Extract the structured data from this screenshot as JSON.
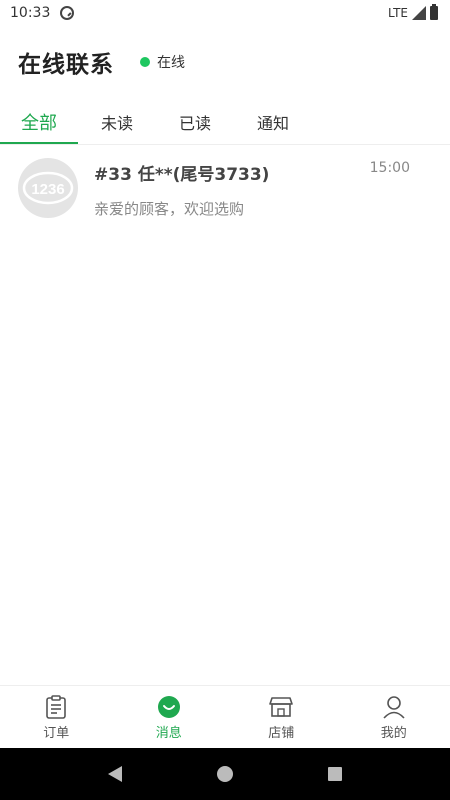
{
  "status_bar": {
    "time": "10:33",
    "network": "LTE"
  },
  "header": {
    "title": "在线联系",
    "status_label": "在线",
    "status_color": "#1ec760"
  },
  "tabs": [
    {
      "label": "全部",
      "active": true
    },
    {
      "label": "未读",
      "active": false
    },
    {
      "label": "已读",
      "active": false
    },
    {
      "label": "通知",
      "active": false
    }
  ],
  "conversations": [
    {
      "name": "#33 任**(尾号3733)",
      "time": "15:00",
      "preview": "亲爱的顾客，欢迎选购",
      "avatar_text": "1236"
    }
  ],
  "bottom_nav": [
    {
      "label": "订单",
      "icon": "clipboard-icon",
      "active": false
    },
    {
      "label": "消息",
      "icon": "message-icon",
      "active": true
    },
    {
      "label": "店铺",
      "icon": "store-icon",
      "active": false
    },
    {
      "label": "我的",
      "icon": "person-icon",
      "active": false
    }
  ],
  "colors": {
    "accent": "#1fa84f"
  }
}
